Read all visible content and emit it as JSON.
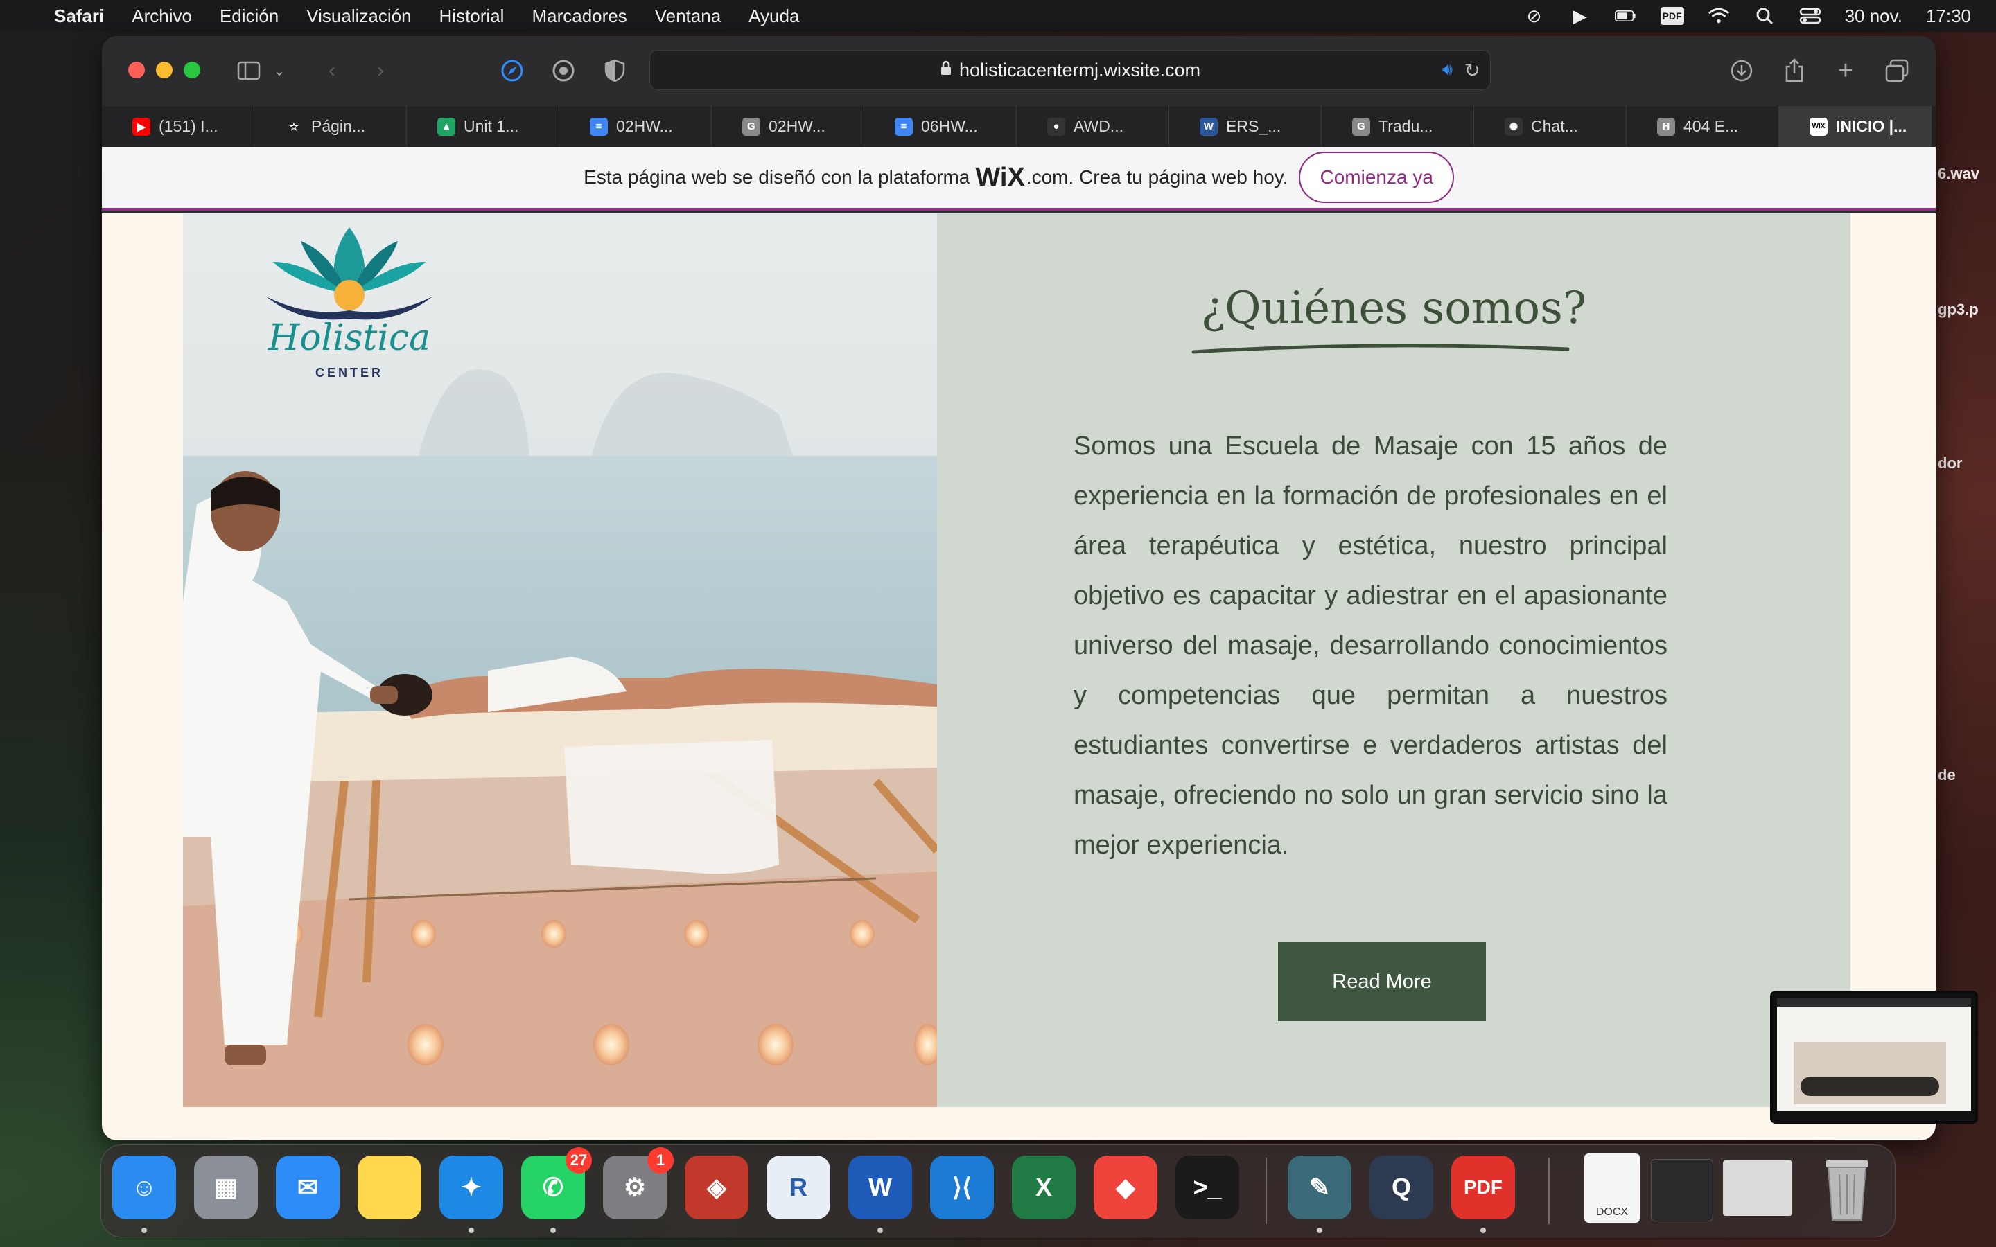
{
  "menubar": {
    "app": "Safari",
    "items": [
      "Archivo",
      "Edición",
      "Visualización",
      "Historial",
      "Marcadores",
      "Ventana",
      "Ayuda"
    ],
    "date": "30 nov.",
    "time": "17:30",
    "pdf_label": "PDF"
  },
  "desktop": {
    "labels": [
      "6.wav",
      "gp3.p",
      "dor",
      "de"
    ]
  },
  "browser": {
    "url": "holisticacentermj.wixsite.com",
    "tabs": [
      {
        "label": "(151) I...",
        "fav": "▶",
        "color": "#ff0000"
      },
      {
        "label": "Págin...",
        "fav": "☆",
        "color": "transparent"
      },
      {
        "label": "Unit 1...",
        "fav": "▲",
        "color": "#1fa463"
      },
      {
        "label": "02HW...",
        "fav": "≡",
        "color": "#4285f4"
      },
      {
        "label": "02HW...",
        "fav": "G",
        "color": "#8a8a8a"
      },
      {
        "label": "06HW...",
        "fav": "≡",
        "color": "#4285f4"
      },
      {
        "label": "AWD...",
        "fav": "●",
        "color": "#333"
      },
      {
        "label": "ERS_...",
        "fav": "W",
        "color": "#2b579a"
      },
      {
        "label": "Tradu...",
        "fav": "G",
        "color": "#8a8a8a"
      },
      {
        "label": "Chat...",
        "fav": "✺",
        "color": "#333"
      },
      {
        "label": "404 E...",
        "fav": "H",
        "color": "#8a8a8a"
      },
      {
        "label": "INICIO |...",
        "fav": "WIX",
        "color": "#000"
      }
    ]
  },
  "wix_banner": {
    "text_before": "Esta página web se diseñó con la plataforma",
    "wix_logo": "WiX",
    "text_after": ".com. Crea tu página web hoy.",
    "cta": "Comienza ya"
  },
  "site": {
    "logo_name": "Holistica",
    "logo_sub": "CENTER",
    "heading": "¿Quiénes somos?",
    "body": "Somos una Escuela de Masaje con 15 años de experiencia en la formación de profesionales en el área terapéutica y estética,  nuestro principal objetivo es capacitar y adiestrar en el apasionante universo del masaje, desarrollando conocimientos y competencias que permitan a nuestros estudiantes convertirse e verdaderos artistas del masaje, ofreciendo no solo un gran servicio sino la mejor experiencia.",
    "read_more": "Read More"
  },
  "dock": {
    "apps": [
      {
        "name": "finder-app",
        "label": "☺",
        "color": "#2a8cf0"
      },
      {
        "name": "launchpad-app",
        "label": "▦",
        "color": "#8a8f98"
      },
      {
        "name": "mail-app",
        "label": "✉",
        "color": "#2d8cf6"
      },
      {
        "name": "notes-app",
        "label": "",
        "color": "#ffd84d"
      },
      {
        "name": "safari-app",
        "label": "✦",
        "color": "#1e88e5"
      },
      {
        "name": "whatsapp-app",
        "label": "✆",
        "color": "#25d366",
        "badge": "27"
      },
      {
        "name": "system-settings-app",
        "label": "⚙",
        "color": "#7d7d82",
        "badge": "1"
      },
      {
        "name": "sketchup-app",
        "label": "◈",
        "color": "#c0392b"
      },
      {
        "name": "r-app",
        "label": "R",
        "color": "#e8eef6"
      },
      {
        "name": "word-app",
        "label": "W",
        "color": "#1e5bb8"
      },
      {
        "name": "vscode-app",
        "label": "⟩⟨",
        "color": "#1a7ad4"
      },
      {
        "name": "excel-app",
        "label": "X",
        "color": "#1f7a43"
      },
      {
        "name": "anydesk-app",
        "label": "◆",
        "color": "#ef443b"
      },
      {
        "name": "terminal-app",
        "label": ">_",
        "color": "#1b1b1b"
      },
      {
        "name": "clean-app",
        "label": "✎",
        "color": "#3b6a78"
      },
      {
        "name": "quicktime-app",
        "label": "Q",
        "color": "#2c3a52"
      },
      {
        "name": "pdf-app",
        "label": "PDF",
        "color": "#e0322a"
      }
    ],
    "doc_label": "DOCX"
  }
}
